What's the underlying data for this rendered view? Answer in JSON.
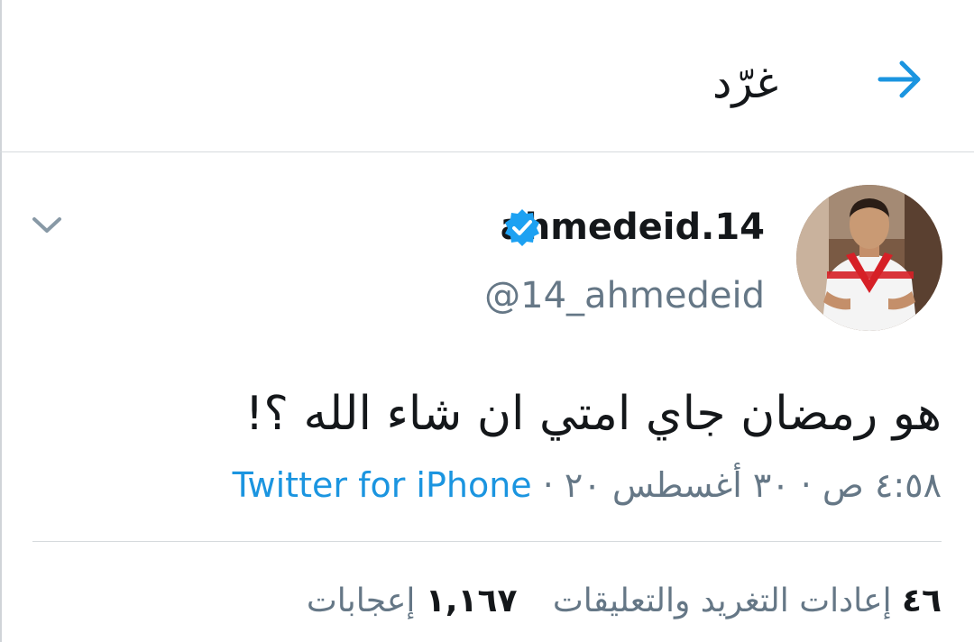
{
  "header": {
    "title": "غرّد"
  },
  "tweet": {
    "display_name": "ahmedeid.14",
    "handle": "@14_ahmedeid",
    "text": "هو رمضان جاي امتي ان شاء الله ؟!",
    "timestamp": "٤:٥٨ ص · ٣٠ أغسطس ٢٠",
    "separator": " · ",
    "source": "Twitter for iPhone"
  },
  "stats": {
    "retweets_count": "٤٦",
    "retweets_label": "إعادات التغريد والتعليقات",
    "likes_count": "١,١٦٧",
    "likes_label": "إعجابات"
  },
  "icons": {
    "back": "arrow-right-icon",
    "caret": "chevron-down-icon",
    "verified": "verified-badge-icon"
  },
  "colors": {
    "accent": "#1b95e0",
    "secondary_text": "#657786",
    "primary_text": "#14171a"
  }
}
